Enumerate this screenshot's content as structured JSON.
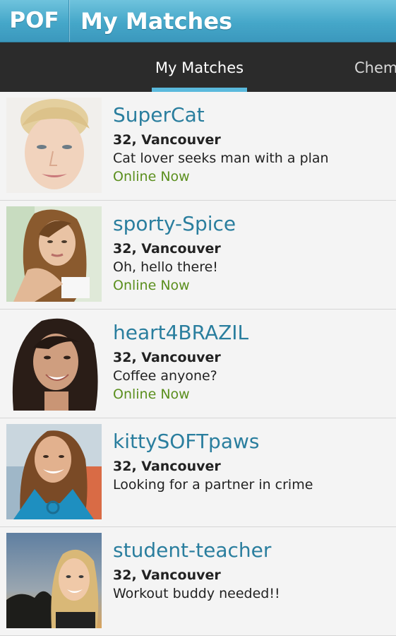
{
  "header": {
    "logo": "POF",
    "title": "My Matches"
  },
  "tabs": [
    {
      "label": "My Matches",
      "selected": true
    },
    {
      "label": "Chemi",
      "selected": false
    }
  ],
  "colors": {
    "header": "#45a7c9",
    "tab_indicator": "#5ab9dc",
    "name": "#2a7e9e",
    "online": "#5b8f1e"
  },
  "matches": [
    {
      "name": "SuperCat",
      "meta": "32, Vancouver",
      "tagline": "Cat lover seeks man with a plan",
      "status": "Online Now"
    },
    {
      "name": "sporty-Spice",
      "meta": "32, Vancouver",
      "tagline": "Oh, hello there!",
      "status": "Online Now"
    },
    {
      "name": "heart4BRAZIL",
      "meta": "32, Vancouver",
      "tagline": "Coffee anyone?",
      "status": "Online Now"
    },
    {
      "name": "kittySOFTpaws",
      "meta": "32, Vancouver",
      "tagline": "Looking for a partner in crime",
      "status": ""
    },
    {
      "name": "student-teacher",
      "meta": "32, Vancouver",
      "tagline": "Workout buddy needed!!",
      "status": ""
    }
  ]
}
